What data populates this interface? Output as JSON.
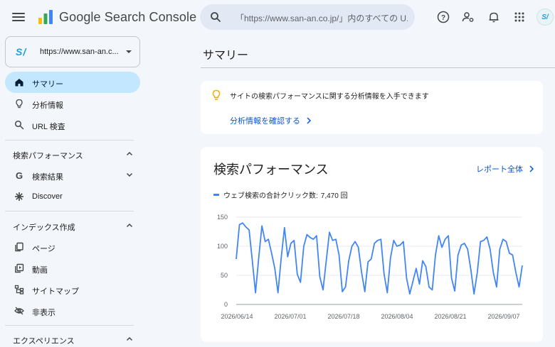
{
  "app": {
    "title": "Google Search Console"
  },
  "search": {
    "placeholder": "「https://www.san-an.co.jp/」内のすべての U..."
  },
  "topbar_icons": [
    "help-icon",
    "manage-users-icon",
    "notifications-icon",
    "apps-icon"
  ],
  "avatar": {
    "text": "S/"
  },
  "property": {
    "logo": "S/",
    "url": "https://www.san-an.c..."
  },
  "nav": {
    "summary": "サマリー",
    "insights": "分析情報",
    "url_inspection": "URL 検査",
    "section_performance": "検索パフォーマンス",
    "search_results": "検索結果",
    "discover": "Discover",
    "section_index": "インデックス作成",
    "pages": "ページ",
    "videos": "動画",
    "sitemaps": "サイトマップ",
    "removals": "非表示",
    "section_experience": "エクスペリエンス"
  },
  "main": {
    "title": "サマリー",
    "insight_text": "サイトの検索パフォーマンスに関する分析情報を入手できます",
    "insight_link": "分析情報を確認する",
    "perf_title": "検索パフォーマンス",
    "perf_link": "レポート全体",
    "legend_label": "ウェブ検索の合計クリック数:",
    "legend_value": "7,470 回"
  },
  "colors": {
    "accent": "#0b57d0",
    "series": "#4285f4",
    "active_nav": "#c2e7ff"
  },
  "chart_data": {
    "type": "line",
    "series": [
      {
        "name": "ウェブ検索の合計クリック数",
        "values": [
          78,
          137,
          140,
          133,
          128,
          75,
          20,
          80,
          135,
          108,
          112,
          88,
          62,
          20,
          80,
          132,
          82,
          105,
          110,
          52,
          38,
          100,
          120,
          115,
          112,
          118,
          48,
          25,
          75,
          124,
          110,
          112,
          85,
          22,
          30,
          75,
          100,
          108,
          98,
          55,
          22,
          73,
          78,
          105,
          110,
          112,
          52,
          20,
          80,
          110,
          100,
          102,
          108,
          45,
          18,
          40,
          62,
          35,
          75,
          65,
          30,
          25,
          85,
          118,
          98,
          112,
          118,
          45,
          23,
          85,
          102,
          105,
          95,
          60,
          18,
          55,
          108,
          110,
          116,
          95,
          55,
          30,
          95,
          112,
          108,
          88,
          85,
          55,
          30,
          67
        ]
      }
    ],
    "x_tick_labels": [
      "2026/06/14",
      "2026/07/01",
      "2026/07/18",
      "2026/08/04",
      "2026/08/21",
      "2026/09/07"
    ],
    "y_tick_labels": [
      "150",
      "100",
      "50",
      "0"
    ],
    "ylim": [
      0,
      150
    ],
    "grid": true
  }
}
